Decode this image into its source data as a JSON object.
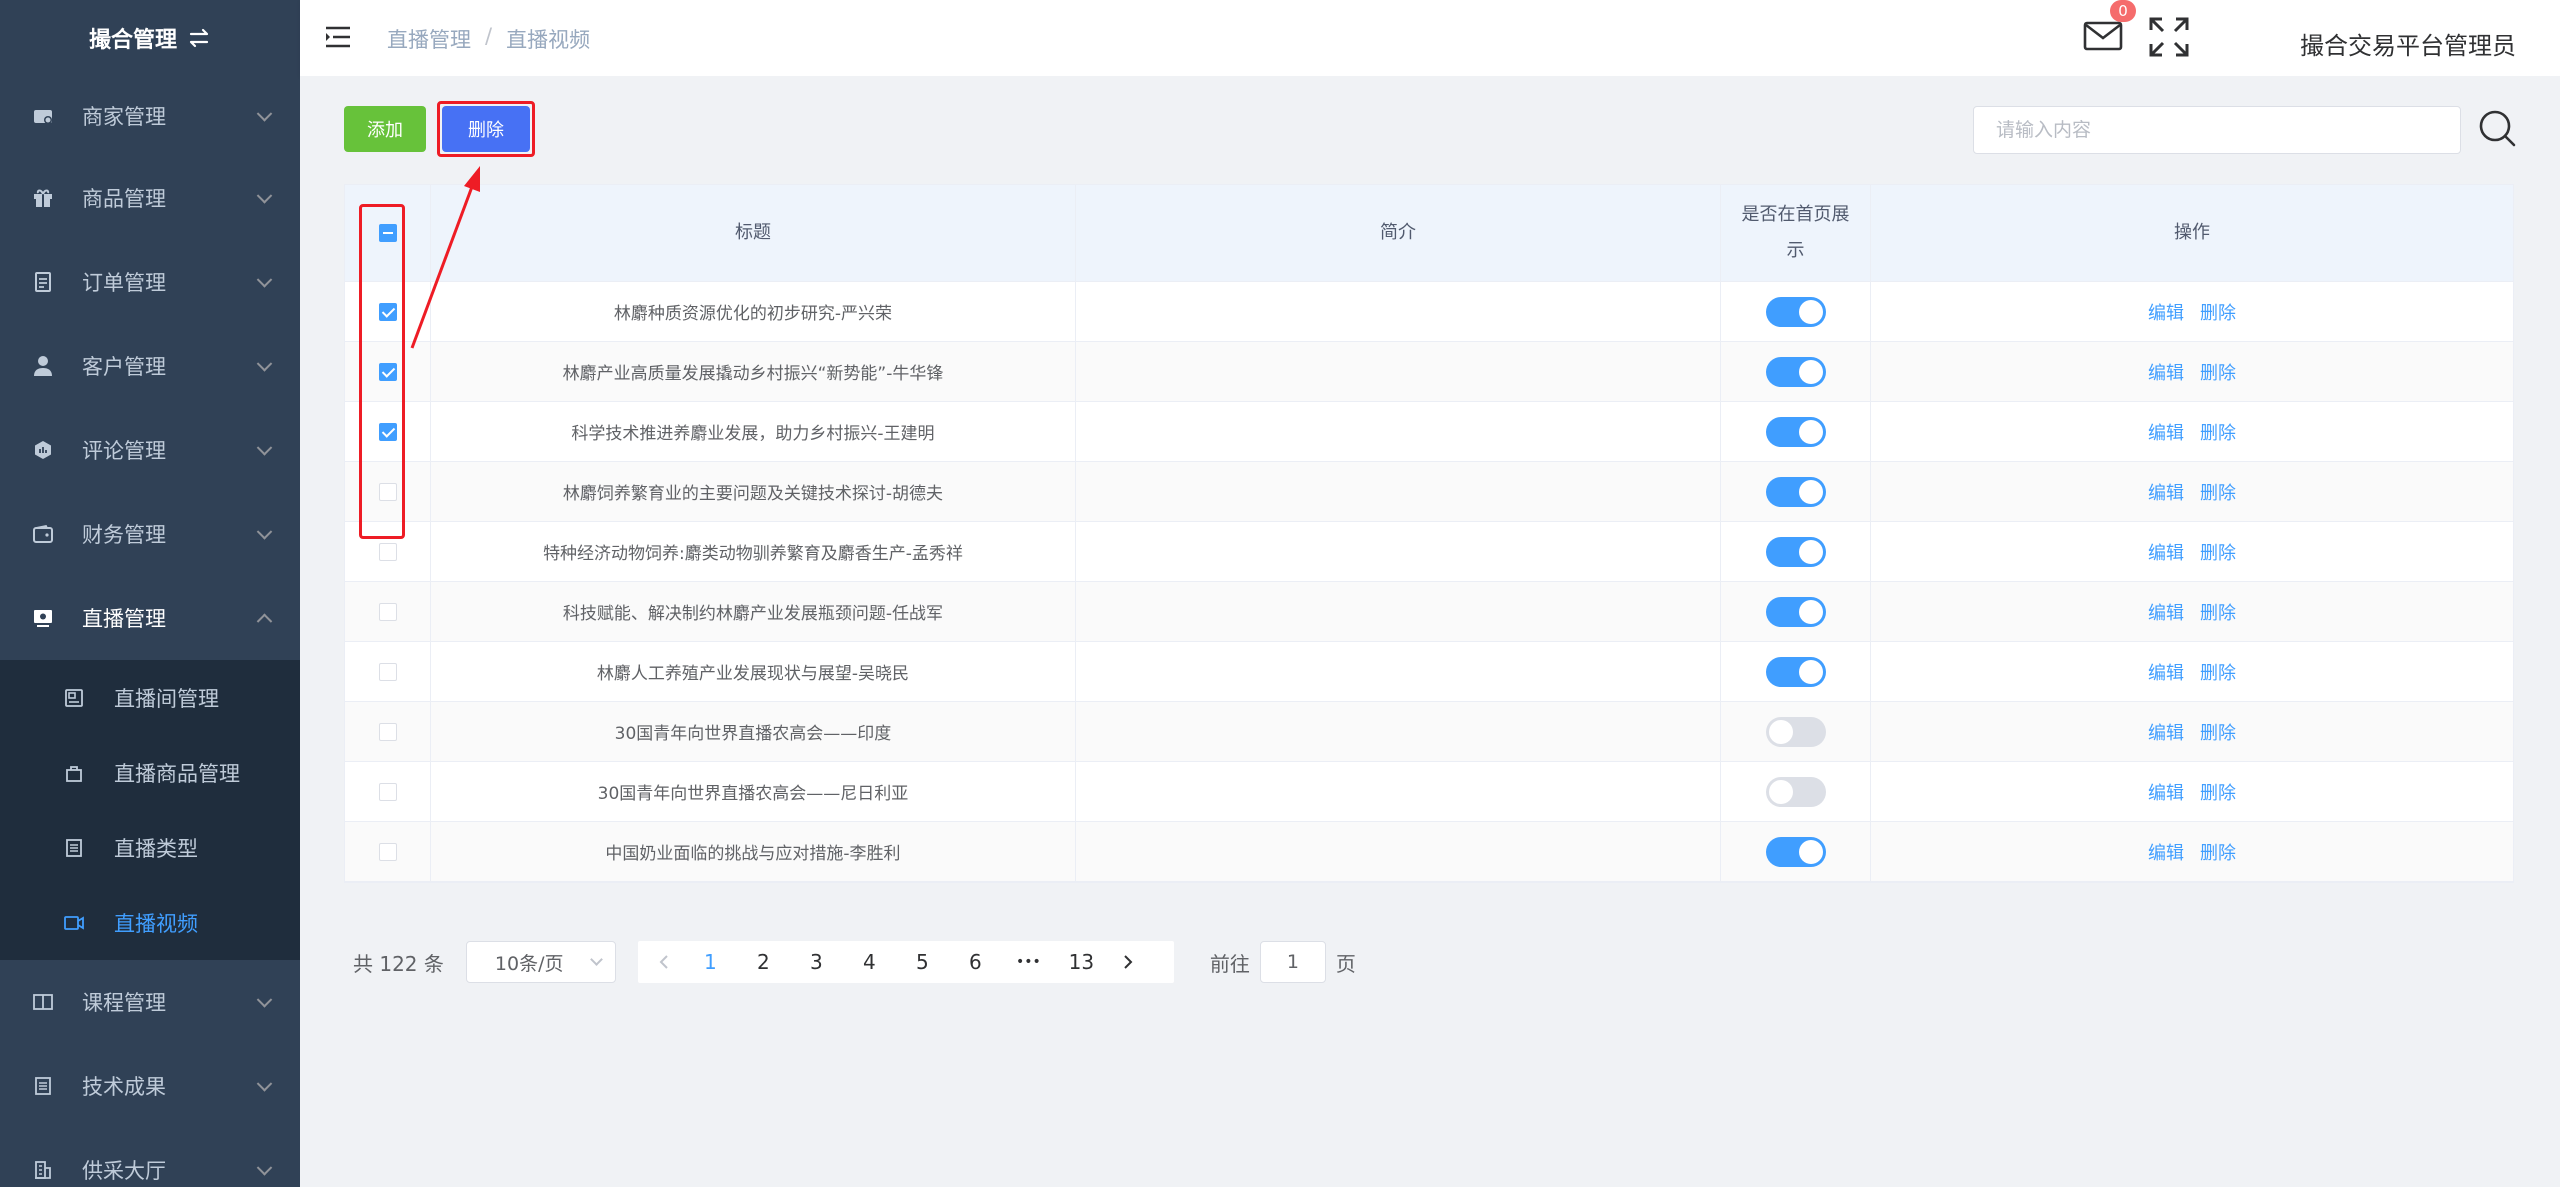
{
  "sidebar": {
    "title": "撮合管理",
    "menu": [
      {
        "label": "商家管理",
        "icon": "store-icon"
      },
      {
        "label": "商品管理",
        "icon": "gift-icon"
      },
      {
        "label": "订单管理",
        "icon": "order-icon"
      },
      {
        "label": "客户管理",
        "icon": "user-icon"
      },
      {
        "label": "评论管理",
        "icon": "comment-icon"
      },
      {
        "label": "财务管理",
        "icon": "wallet-icon"
      },
      {
        "label": "直播管理",
        "icon": "live-icon"
      }
    ],
    "live_sub": [
      {
        "label": "直播间管理"
      },
      {
        "label": "直播商品管理"
      },
      {
        "label": "直播类型"
      },
      {
        "label": "直播视频"
      }
    ],
    "menu_after": [
      {
        "label": "课程管理"
      },
      {
        "label": "技术成果"
      },
      {
        "label": "供采大厅"
      }
    ]
  },
  "header": {
    "breadcrumb": [
      "直播管理",
      "直播视频"
    ],
    "breadcrumb_sep": "/",
    "notification_count": "0",
    "user_name": "撮合交易平台管理员"
  },
  "toolbar": {
    "add_label": "添加",
    "delete_label": "删除",
    "search_placeholder": "请输入内容"
  },
  "table": {
    "columns": [
      "标题",
      "简介",
      "是否在首页展示",
      "操作"
    ],
    "edit_label": "编辑",
    "delete_label": "删除",
    "rows": [
      {
        "title": "林麝种质资源优化的初步研究-严兴荣",
        "intro": "",
        "show": true,
        "checked": true
      },
      {
        "title": "林麝产业高质量发展撬动乡村振兴“新势能”-牛华锋",
        "intro": "",
        "show": true,
        "checked": true
      },
      {
        "title": "科学技术推进养麝业发展，助力乡村振兴-王建明",
        "intro": "",
        "show": true,
        "checked": true
      },
      {
        "title": "林麝饲养繁育业的主要问题及关键技术探讨-胡德夫",
        "intro": "",
        "show": true,
        "checked": false
      },
      {
        "title": "特种经济动物饲养:麝类动物驯养繁育及麝香生产-孟秀祥",
        "intro": "",
        "show": true,
        "checked": false
      },
      {
        "title": "科技赋能、解决制约林麝产业发展瓶颈问题-任战军",
        "intro": "",
        "show": true,
        "checked": false
      },
      {
        "title": "林麝人工养殖产业发展现状与展望-吴晓民",
        "intro": "",
        "show": true,
        "checked": false
      },
      {
        "title": "30国青年向世界直播农高会——印度",
        "intro": "",
        "show": false,
        "checked": false
      },
      {
        "title": "30国青年向世界直播农高会——尼日利亚",
        "intro": "",
        "show": false,
        "checked": false
      },
      {
        "title": "中国奶业面临的挑战与应对措施-李胜利",
        "intro": "",
        "show": true,
        "checked": false
      }
    ]
  },
  "pagination": {
    "total_text": "共 122 条",
    "page_size": "10条/页",
    "pages": [
      "1",
      "2",
      "3",
      "4",
      "5",
      "6",
      "•••",
      "13"
    ],
    "current": "1",
    "goto_prefix": "前往",
    "goto_value": "1",
    "goto_suffix": "页"
  },
  "colors": {
    "primary": "#409eff",
    "add": "#67c23a",
    "delete": "#4771f4",
    "annotation": "#ee1c25",
    "sidebar": "#304156"
  }
}
